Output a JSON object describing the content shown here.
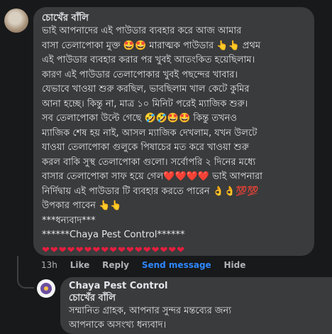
{
  "comment": {
    "author": "চোখেঁর বাঁলি",
    "lines": [
      "ভাই আপনাদের এই পাউডার ব্যবহার করে আজ আমার",
      "বাসা তেলাপোকা মুক্ত 🤩🤩 মারাত্মক পাউডার 👆👆 প্রথম",
      "এই পাউডার ব্যবহার করার পর খুবই আতংকিত হয়েছিলাম।",
      "কারণ এই পাউডার তেলাপোকার খুবই পছন্দের খাবার।",
      "যেভাবে খাওয়া শুরু করছিল, ভাবছিলাম খাল কেটে কুমির",
      "আনা হচ্ছে। কিন্তু না, মাত্র ১০ মিনিট পরেই ম্যাজিক শুরু।",
      "সব তেলাপোকা উল্টে গেছে 🤣🤣🤩🤩 কিন্তু তখনও",
      "ম্যাজিক শেষ হয় নাই, আসল ম্যাজিক দেখলাম, যখন উলটে",
      "যাওয়া তেলাপোকা গুলুকে পিষাচের মত করে খাওয়া শুরু",
      "করল বাকি সুস্থ তেলাপোকা গুলো। সর্বোপরি ২ দিনের মধ্যে",
      "বাসার তেলাপোকা সাফ হয়ে গেল❤️❤️❤️❤️ ভাই আপনারা",
      "নির্দিদ্বায় এই পাউডার টি ব্যবহার করতে পারেন 👌👌💯💯",
      "উপকার পাবেন 👆👆",
      "***ধন্যবাদ***",
      "******Chaya Pest Control******"
    ],
    "hearts": "❤❤❤❤❤❤❤❤❤❤❤❤❤❤❤❤❤"
  },
  "actions": {
    "time": "13h",
    "like": "Like",
    "reply": "Reply",
    "send_message": "Send message",
    "hide": "Hide"
  },
  "reply": {
    "author": "Chaya Pest Control",
    "quoted_name": "চোখেঁর বাঁলি",
    "lines": [
      "সম্মানিত গ্রাহক, আপনার সুন্দর মন্তব্যের জন্য",
      "আপনাকে অসংখ্য ধন্যবাদ।"
    ]
  },
  "colors": {
    "background": "#18191a",
    "bubble": "#3a3b3c",
    "link": "#2d88ff",
    "heart": "#e41e3f"
  }
}
